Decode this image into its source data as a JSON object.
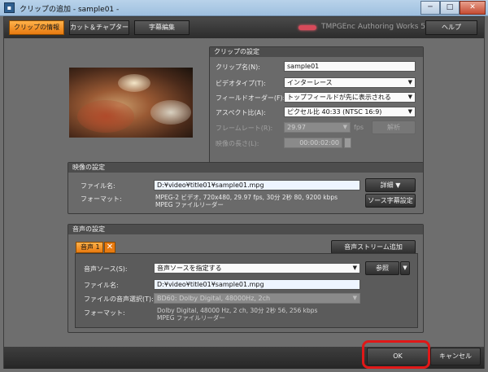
{
  "window": {
    "title": "クリップの追加 - sample01 -",
    "icon": "app-icon",
    "minimize": "─",
    "maximize": "□",
    "close": "✕"
  },
  "tabs": [
    {
      "label": "クリップの情報",
      "active": true
    },
    {
      "label": "カット＆チャプター",
      "active": false
    },
    {
      "label": "字幕編集",
      "active": false
    }
  ],
  "brand": "TMPGEnc Authoring Works 5",
  "help_label": "ヘルプ",
  "clip_settings": {
    "title": "クリップの設定",
    "clip_name_label": "クリップ名(N):",
    "clip_name_value": "sample01",
    "video_type_label": "ビデオタイプ(T):",
    "video_type_value": "インターレース",
    "field_order_label": "フィールドオーダー(F):",
    "field_order_value": "トップフィールドが先に表示される",
    "aspect_label": "アスペクト比(A):",
    "aspect_value": "ピクセル比 40:33 (NTSC 16:9)",
    "framerate_label": "フレームレート(R):",
    "framerate_value": "29.97",
    "fps_unit": "fps",
    "analyze_label": "解析",
    "length_label": "映像の長さ(L):",
    "length_value": "00:00:02:00"
  },
  "video_settings": {
    "title": "映像の設定",
    "file_label": "ファイル名:",
    "file_value": "D:¥video¥title01¥sample01.mpg",
    "details_label": "詳細",
    "format_label": "フォーマット:",
    "format_line1": "MPEG-2 ビデオ, 720x480, 29.97 fps, 30分 2秒 80, 9200 kbps",
    "format_line2": "MPEG ファイルリーダー",
    "source_subtitle_label": "ソース字幕設定"
  },
  "audio_settings": {
    "title": "音声の設定",
    "tab_label": "音声 1",
    "add_stream_label": "音声ストリーム追加",
    "source_label": "音声ソース(S):",
    "source_value": "音声ソースを指定する",
    "browse_label": "参照",
    "file_label": "ファイル名:",
    "file_value": "D:¥video¥title01¥sample01.mpg",
    "file_audio_label": "ファイルの音声選択(T):",
    "file_audio_value": "BD60: Dolby Digital, 48000Hz, 2ch",
    "format_label": "フォーマット:",
    "format_line1": "Dolby Digital, 48000 Hz, 2 ch, 30分 2秒 56, 256 kbps",
    "format_line2": "MPEG ファイルリーダー"
  },
  "footer": {
    "ok_label": "OK",
    "cancel_label": "キャンセル"
  },
  "colors": {
    "accent_orange": "#f09020",
    "highlight_red": "#e01818",
    "background": "#6e6e6e"
  }
}
